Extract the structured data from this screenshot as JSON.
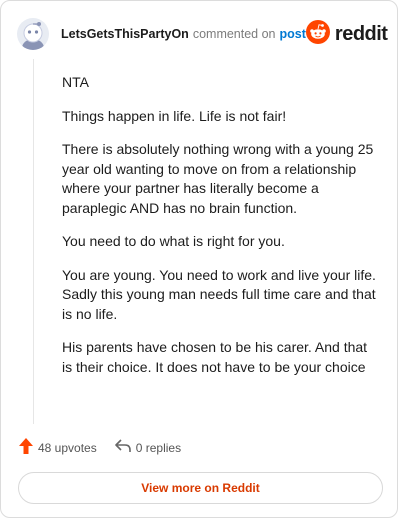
{
  "header": {
    "username": "LetsGetsThisPartyOn",
    "commented_text": "commented on",
    "post_link": "post",
    "brand": "reddit"
  },
  "comment": {
    "paragraphs": [
      "NTA",
      "Things happen in life. Life is not fair!",
      "There is absolutely nothing wrong with a young 25 year old wanting to move on from a relationship where your partner has literally become a paraplegic AND has no brain function.",
      "You need to do what is right for you.",
      "You are young. You need to work and live your life. Sadly this young man needs full time care and that is no life.",
      "His parents have chosen to be his carer. And that is their choice. It does not have to be your choice"
    ]
  },
  "actions": {
    "upvotes": "48 upvotes",
    "replies": "0 replies"
  },
  "footer": {
    "view_more": "View more on Reddit"
  },
  "colors": {
    "upvote": "#ff4500",
    "brand_orange": "#ff4500",
    "link_blue": "#0079d3",
    "view_more": "#d93a00"
  },
  "icons": {
    "avatar": "snoo-avatar-icon",
    "brand": "reddit-logo-icon",
    "upvote": "upvote-arrow-icon",
    "reply": "reply-arrow-icon"
  }
}
